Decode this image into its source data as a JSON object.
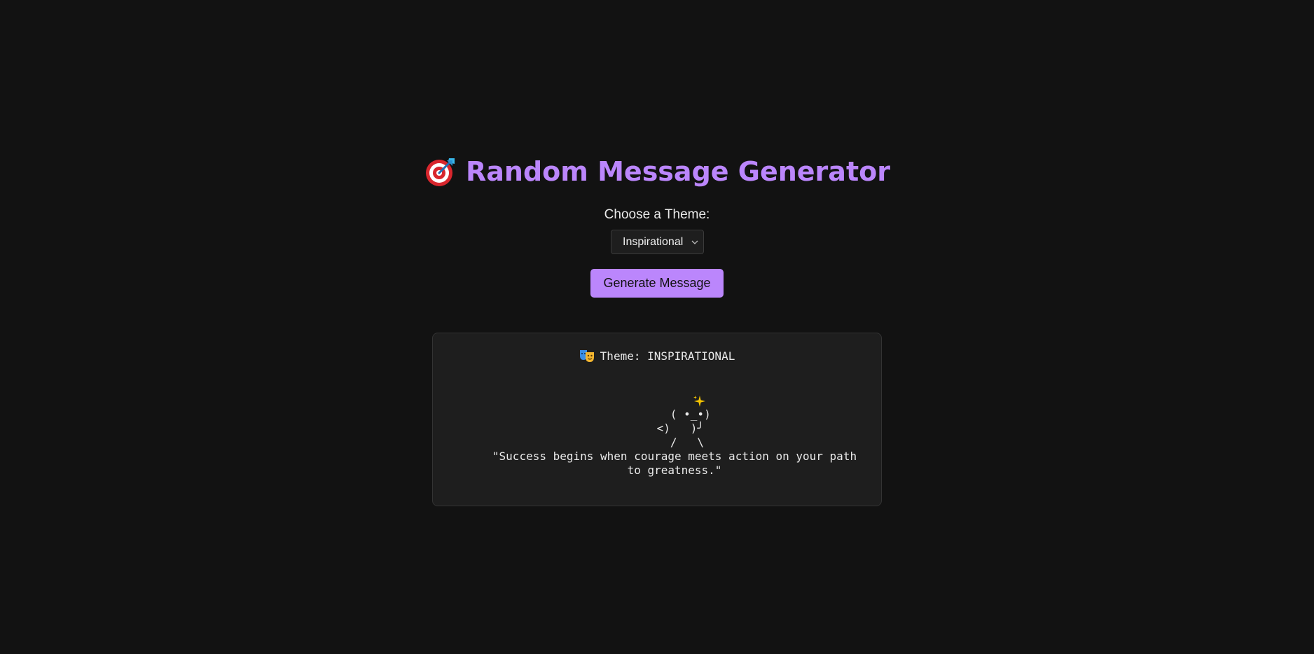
{
  "header": {
    "icon": "target-dart-icon",
    "title": "Random Message Generator"
  },
  "controls": {
    "theme_label": "Choose a Theme:",
    "theme_selected": "Inspirational",
    "generate_label": "Generate Message"
  },
  "output": {
    "theme_icon": "theater-masks-icon",
    "theme_line": "Theme: INSPIRATIONAL",
    "art_icon": "sparkle-icon",
    "ascii_art": "   ( •_•)\n <)   )╯\n   /   \\",
    "message": "\"Success begins when courage meets action on your path to greatness.\""
  },
  "colors": {
    "background": "#121212",
    "accent": "#bb86fc",
    "card": "#1e1e1e",
    "text": "#eaeaea"
  }
}
